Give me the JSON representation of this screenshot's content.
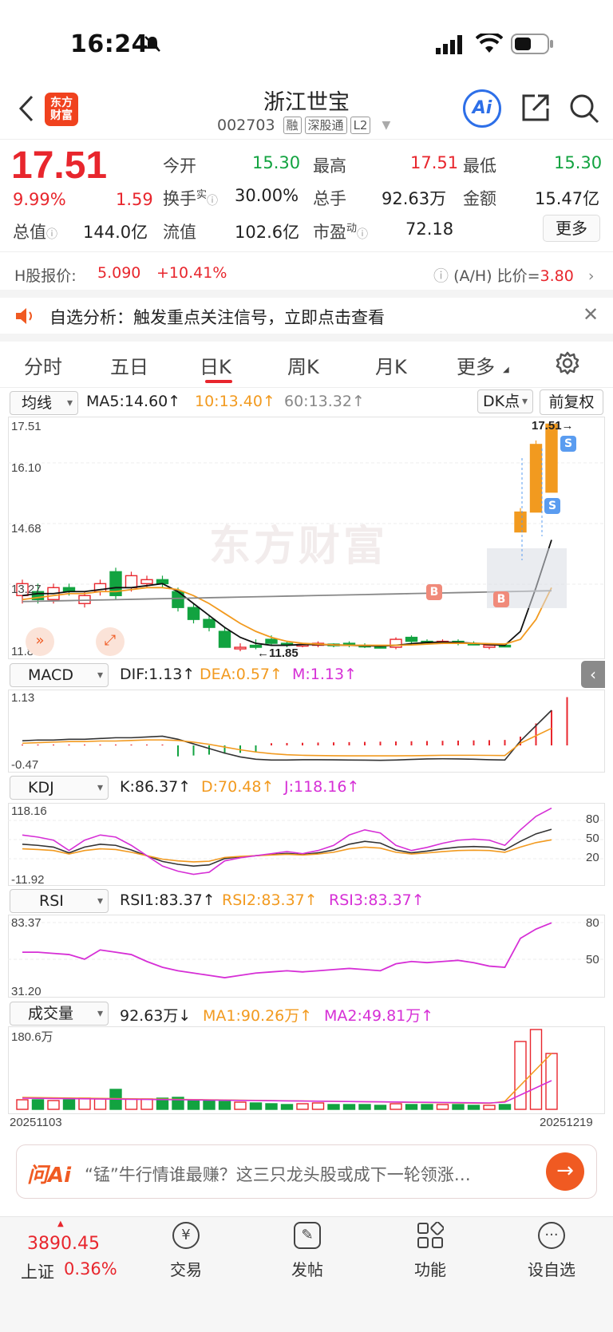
{
  "status_bar": {
    "time": "16:24"
  },
  "header": {
    "title": "浙江世宝",
    "code": "002703",
    "tags": [
      "融",
      "深股通",
      "L2"
    ],
    "logo_text": "东方\n财富"
  },
  "quote": {
    "price": "17.51",
    "change_pct": "9.99%",
    "change": "1.59",
    "fields": {
      "open_label": "今开",
      "open": "15.30",
      "high_label": "最高",
      "high": "17.51",
      "low_label": "最低",
      "low": "15.30",
      "turnover_label": "换手",
      "turnover_sup": "实",
      "turnover": "30.00%",
      "volume_label": "总手",
      "volume": "92.63万",
      "amount_label": "金额",
      "amount": "15.47亿",
      "mktcap_label": "总值",
      "mktcap": "144.0亿",
      "float_label": "流值",
      "float": "102.6亿",
      "pe_label": "市盈",
      "pe_sup": "动",
      "pe": "72.18"
    },
    "more_button": "更多"
  },
  "h_share": {
    "label": "H股报价:",
    "price": "5.090",
    "change": "+10.41%",
    "ah_label": "(A/H) 比价=",
    "ah_value": "3.80"
  },
  "alert": {
    "text": "自选分析：触发重点关注信号，立即点击查看"
  },
  "tabs": [
    "分时",
    "五日",
    "日K",
    "周K",
    "月K",
    "更多"
  ],
  "active_tab": "日K",
  "kline": {
    "ma_selector": "均线",
    "ma5": "MA5:14.60",
    "ma10": "10:13.40",
    "ma60": "60:13.32",
    "dk_button": "DK点",
    "adjust_button": "前复权",
    "y_labels": [
      "17.51",
      "16.10",
      "14.68",
      "13.27",
      "11.85"
    ],
    "high_marker": "17.51",
    "low_marker": "11.85",
    "watermark": "东方财富",
    "signals": [
      "B",
      "B",
      "S",
      "S"
    ]
  },
  "macd": {
    "selector": "MACD",
    "dif": "DIF:1.13",
    "dea": "DEA:0.57",
    "m": "M:1.13",
    "y_top": "1.13",
    "y_bottom": "-0.47"
  },
  "kdj": {
    "selector": "KDJ",
    "k": "K:86.37",
    "d": "D:70.48",
    "j": "J:118.16",
    "y_top": "118.16",
    "y_bottom": "-11.92",
    "levels": [
      "80",
      "50",
      "20"
    ]
  },
  "rsi": {
    "selector": "RSI",
    "rsi1": "RSI1:83.37",
    "rsi2": "RSI2:83.37",
    "rsi3": "RSI3:83.37",
    "y_top": "83.37",
    "y_bottom": "31.20",
    "levels": [
      "80",
      "50"
    ]
  },
  "volume": {
    "selector": "成交量",
    "value": "92.63万",
    "ma1": "MA1:90.26万",
    "ma2": "MA2:49.81万",
    "y_top": "180.6万",
    "date_start": "20251103",
    "date_end": "20251219"
  },
  "ai_bar": {
    "brand": "问Ai",
    "prompt": "“锰”牛行情谁最赚？这三只龙头股或成下一轮领涨…"
  },
  "bottom_nav": {
    "index_value": "3890.45",
    "index_name": "上证",
    "index_change": "0.36%",
    "items": [
      "交易",
      "发帖",
      "功能",
      "设自选"
    ]
  },
  "colors": {
    "up": "#e8262d",
    "down": "#12a340",
    "accent": "#f29a1f",
    "magenta": "#d62fd6",
    "ai_blue": "#2d6fe8"
  }
}
